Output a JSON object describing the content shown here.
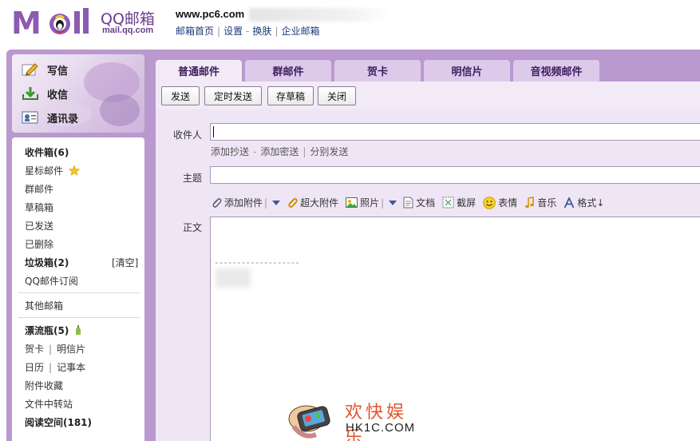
{
  "header": {
    "logo_text": "MOil",
    "brand_title": "QQ邮箱",
    "brand_domain": "mail.qq.com",
    "account": "www.pc6.com",
    "links": [
      "邮箱首页",
      "设置",
      "换肤",
      "企业邮箱"
    ],
    "link_separators": [
      "|",
      "-",
      "|"
    ]
  },
  "sidebar": {
    "actions": [
      {
        "label": "写信",
        "icon": "write-icon"
      },
      {
        "label": "收信",
        "icon": "receive-icon"
      },
      {
        "label": "通讯录",
        "icon": "contacts-icon"
      }
    ],
    "folders": {
      "inbox": "收件箱(6)",
      "starred": "星标邮件",
      "group": "群邮件",
      "drafts": "草稿箱",
      "sent": "已发送",
      "deleted": "已删除",
      "junk": "垃圾箱(2)",
      "junk_clear": "[清空]",
      "subscription": "QQ邮件订阅",
      "other": "其他邮箱",
      "drift_bottle": "漂流瓶(5)",
      "card": "贺卡",
      "postcard": "明信片",
      "calendar": "日历",
      "notes": "记事本",
      "attachments": "附件收藏",
      "transfer": "文件中转站",
      "reading": "阅读空间(181)",
      "pair_separator": "|"
    }
  },
  "tabs": [
    {
      "label": "普通邮件",
      "active": true
    },
    {
      "label": "群邮件",
      "active": false
    },
    {
      "label": "贺卡",
      "active": false
    },
    {
      "label": "明信片",
      "active": false
    },
    {
      "label": "音视频邮件",
      "active": false
    }
  ],
  "toolbar": {
    "send": "发送",
    "scheduled": "定时发送",
    "save_draft": "存草稿",
    "close": "关闭"
  },
  "compose": {
    "to_label": "收件人",
    "to_value": "",
    "cc_links": [
      "添加抄送",
      "添加密送",
      "分别发送"
    ],
    "cc_separators": [
      "-",
      "|"
    ],
    "subject_label": "主题",
    "subject_value": "",
    "body_label": "正文",
    "signature_line": "-------------------",
    "tools": {
      "attach": "添加附件",
      "big_attach": "超大附件",
      "photo": "照片",
      "doc": "文档",
      "screenshot": "截屏",
      "emoji": "表情",
      "music": "音乐",
      "format": "格式↓",
      "separator": "|"
    }
  },
  "watermark": {
    "cn": "欢快娱乐",
    "en": "HK1C.COM"
  },
  "colors": {
    "frame": "#ba99cf",
    "tab": "#ddc9ea",
    "tab_active": "#f2ebf7",
    "compose_bg": "#efe6f5",
    "brand": "#6a3d8e",
    "watermark": "#e0552a"
  }
}
